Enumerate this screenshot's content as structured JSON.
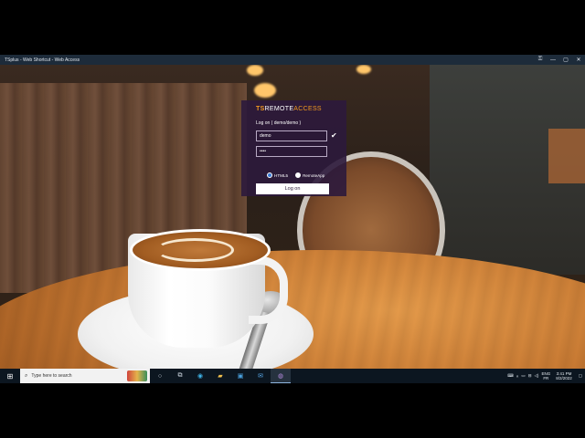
{
  "window": {
    "title": "TSplus - Web Shortcut - Web Access",
    "controls": [
      "⚿",
      "—",
      "▢",
      "✕"
    ]
  },
  "login": {
    "brand_ts": "TS",
    "brand_remote": "REMOTE",
    "brand_access": "ACCESS",
    "logon_title": "Log on ( demo/demo )",
    "username": "demo",
    "password": "••••",
    "check_glyph": "✔",
    "options": [
      {
        "label": "HTML5",
        "selected": true
      },
      {
        "label": "RemoteApp",
        "selected": false
      }
    ],
    "logon_button": "Log on"
  },
  "taskbar": {
    "search_placeholder": "Type here to search",
    "language_top": "ENG",
    "language_bottom": "FR",
    "time": "3:41 PM",
    "date": "8/2/2022"
  }
}
